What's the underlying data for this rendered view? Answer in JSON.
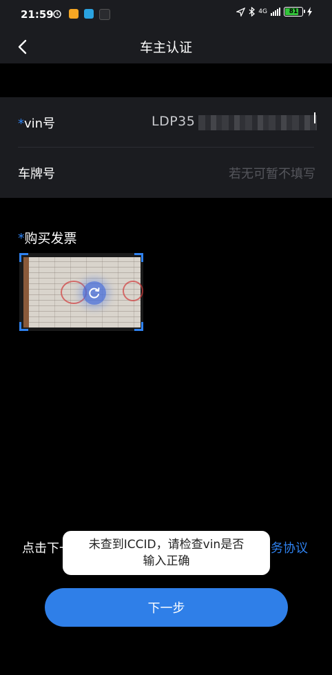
{
  "status_bar": {
    "time": "21:59",
    "network": "4G",
    "battery": "81",
    "battery_level": 0.81,
    "icons": [
      "alarm-icon",
      "notes-app-icon",
      "telegram-icon",
      "wechat-icon",
      "location-arrow-icon",
      "bluetooth-icon",
      "signal-icon",
      "battery-icon",
      "charging-icon"
    ]
  },
  "header": {
    "title": "车主认证",
    "back_icon": "chevron-left-icon"
  },
  "form": {
    "vin": {
      "required_mark": "*",
      "label": "vin号",
      "value": "LDP35"
    },
    "plate": {
      "label": "车牌号",
      "placeholder": "若无可暂不填写"
    }
  },
  "invoice": {
    "required_mark": "*",
    "label": "购买发票",
    "refresh_icon": "refresh-icon"
  },
  "agreement": {
    "prefix": "点击下一",
    "link": "务协议"
  },
  "toast": {
    "line1": "未查到ICCID，请检查vin是否",
    "line2": "输入正确"
  },
  "next_button": {
    "label": "下一步"
  },
  "colors": {
    "accent": "#2f82f0",
    "background": "#000000",
    "surface": "#1b1c20",
    "placeholder": "#55565c",
    "toast_bg": "#ffffff",
    "battery_fill": "#33c43a"
  }
}
